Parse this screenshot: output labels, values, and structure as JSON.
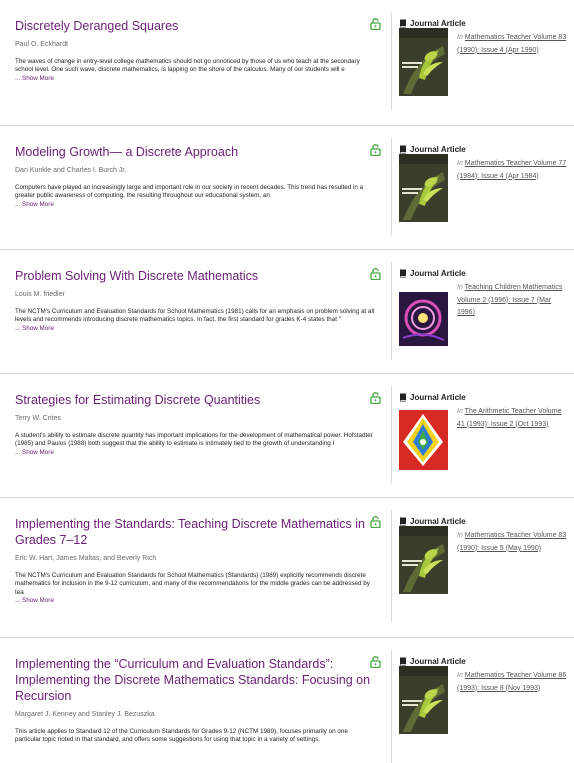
{
  "results": [
    {
      "title": "Discretely Deranged Squares",
      "authors": "Paul O. Eckhardt",
      "abstract": "The waves of change in entry-level college mathematics should not go unnoticed by those of us who teach at the secondary school level. One such wave, discrete mathematics, is lapping on the shore of the calculus. Many of our students will e",
      "show_more": "... Show More",
      "type": "Journal Article",
      "in_label": "In",
      "journal_link": "Mathematics Teacher Volume 83 (1990): Issue 4 (Apr 1990)",
      "cover": "mt"
    },
    {
      "title": "Modeling Growth— a Discrete Approach",
      "authors": "Dan Kunkle and Charles I. Burch Jr.",
      "abstract": "Computers have played an increasingly large and important role in our society in recent decades. This trend has resulted in a greater public awareness of computing, the resulting throughout our educational system, an",
      "show_more": "... Show More",
      "type": "Journal Article",
      "in_label": "In",
      "journal_link": "Mathematics Teacher Volume 77 (1984): Issue 4 (Apr 1984)",
      "cover": "mt"
    },
    {
      "title": "Problem Solving With Discrete Mathematics",
      "authors": "Louis M. friedler",
      "abstract": "The NCTM's Curriculum and Evaluation Standards for School Mathematics (1981) calls for an emphasis on problem solving at all levels and recommends introducing discrete mathematics topics. In fact, the first standard for grades K-4 states that \"",
      "show_more": "... Show More",
      "type": "Journal Article",
      "in_label": "In",
      "journal_link": "Teaching Children Mathematics Volume 2 (1996): Issue 7 (Mar 1996)",
      "cover": "tcm"
    },
    {
      "title": "Strategies for Estimating Discrete Quantities",
      "authors": "Terry W. Crites",
      "abstract": "A student's ability to estimate discrete quantity has important implications for the development of mathematical power. Hofstadter (1985) and Paulos (1988) both suggest that the ability to estimate is intimately tied to the growth of understanding I",
      "show_more": "... Show More",
      "type": "Journal Article",
      "in_label": "In",
      "journal_link": "The Arithmetic Teacher Volume 41 (1993): Issue 2 (Oct 1993)",
      "cover": "at"
    },
    {
      "title": "Implementing the Standards: Teaching Discrete Mathematics in Grades 7–12",
      "authors": "Eric W. Hart, James Maltas, and Beverly Rich",
      "abstract": "The NCTM's Curriculum and Evaluation Standards for School Mathematics (Standards) (1989) explicitly recommends discrete mathematics for inclusion in the 9-12 curriculum, and many of the recommendations for the middle grades can be addressed by tea",
      "show_more": "... Show More",
      "type": "Journal Article",
      "in_label": "In",
      "journal_link": "Mathematics Teacher Volume 83 (1990): Issue 5 (May 1990)",
      "cover": "mt"
    },
    {
      "title": "Implementing the “Curriculum and Evaluation Standards”: Implementing the Discrete Mathematics Standards: Focusing on Recursion",
      "authors": "Margaret J. Kenney and Stanley J. Bezuszka",
      "abstract": "This article applies to Standard 12 of the Curriculum Standards for Grades 9-12 (NCTM 1989), focuses primarily on one particular topic noted in that standard, and offers some suggestions for using that topic in a variety of settings.",
      "show_more": "",
      "type": "Journal Article",
      "in_label": "In",
      "journal_link": "Mathematics Teacher Volume 86 (1993): Issue 8 (Nov 1993)",
      "cover": "mt"
    }
  ],
  "covers": {
    "mt": {
      "masthead": "MATHEMATICS TEACHER",
      "bg": "#3a3f2c",
      "accent": "#a6c83a"
    },
    "tcm": {
      "masthead": "children",
      "badge": "25",
      "bg": "#2a1740",
      "accent": "#d94fb6"
    },
    "at": {
      "masthead": "THE ARITHMETIC TEACHER",
      "bg": "#d72a22",
      "accent": "#f3d21c"
    }
  }
}
